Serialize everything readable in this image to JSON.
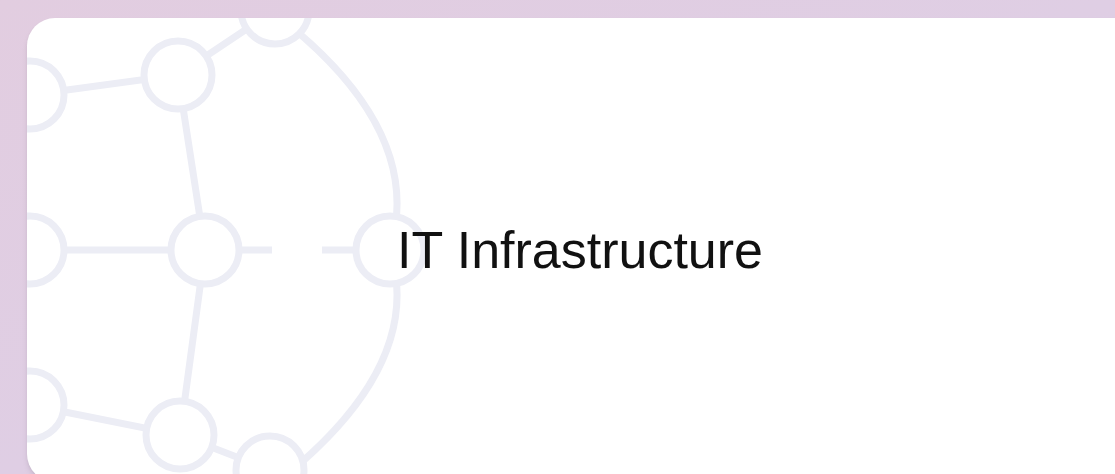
{
  "card": {
    "title": "IT Infrastructure"
  }
}
